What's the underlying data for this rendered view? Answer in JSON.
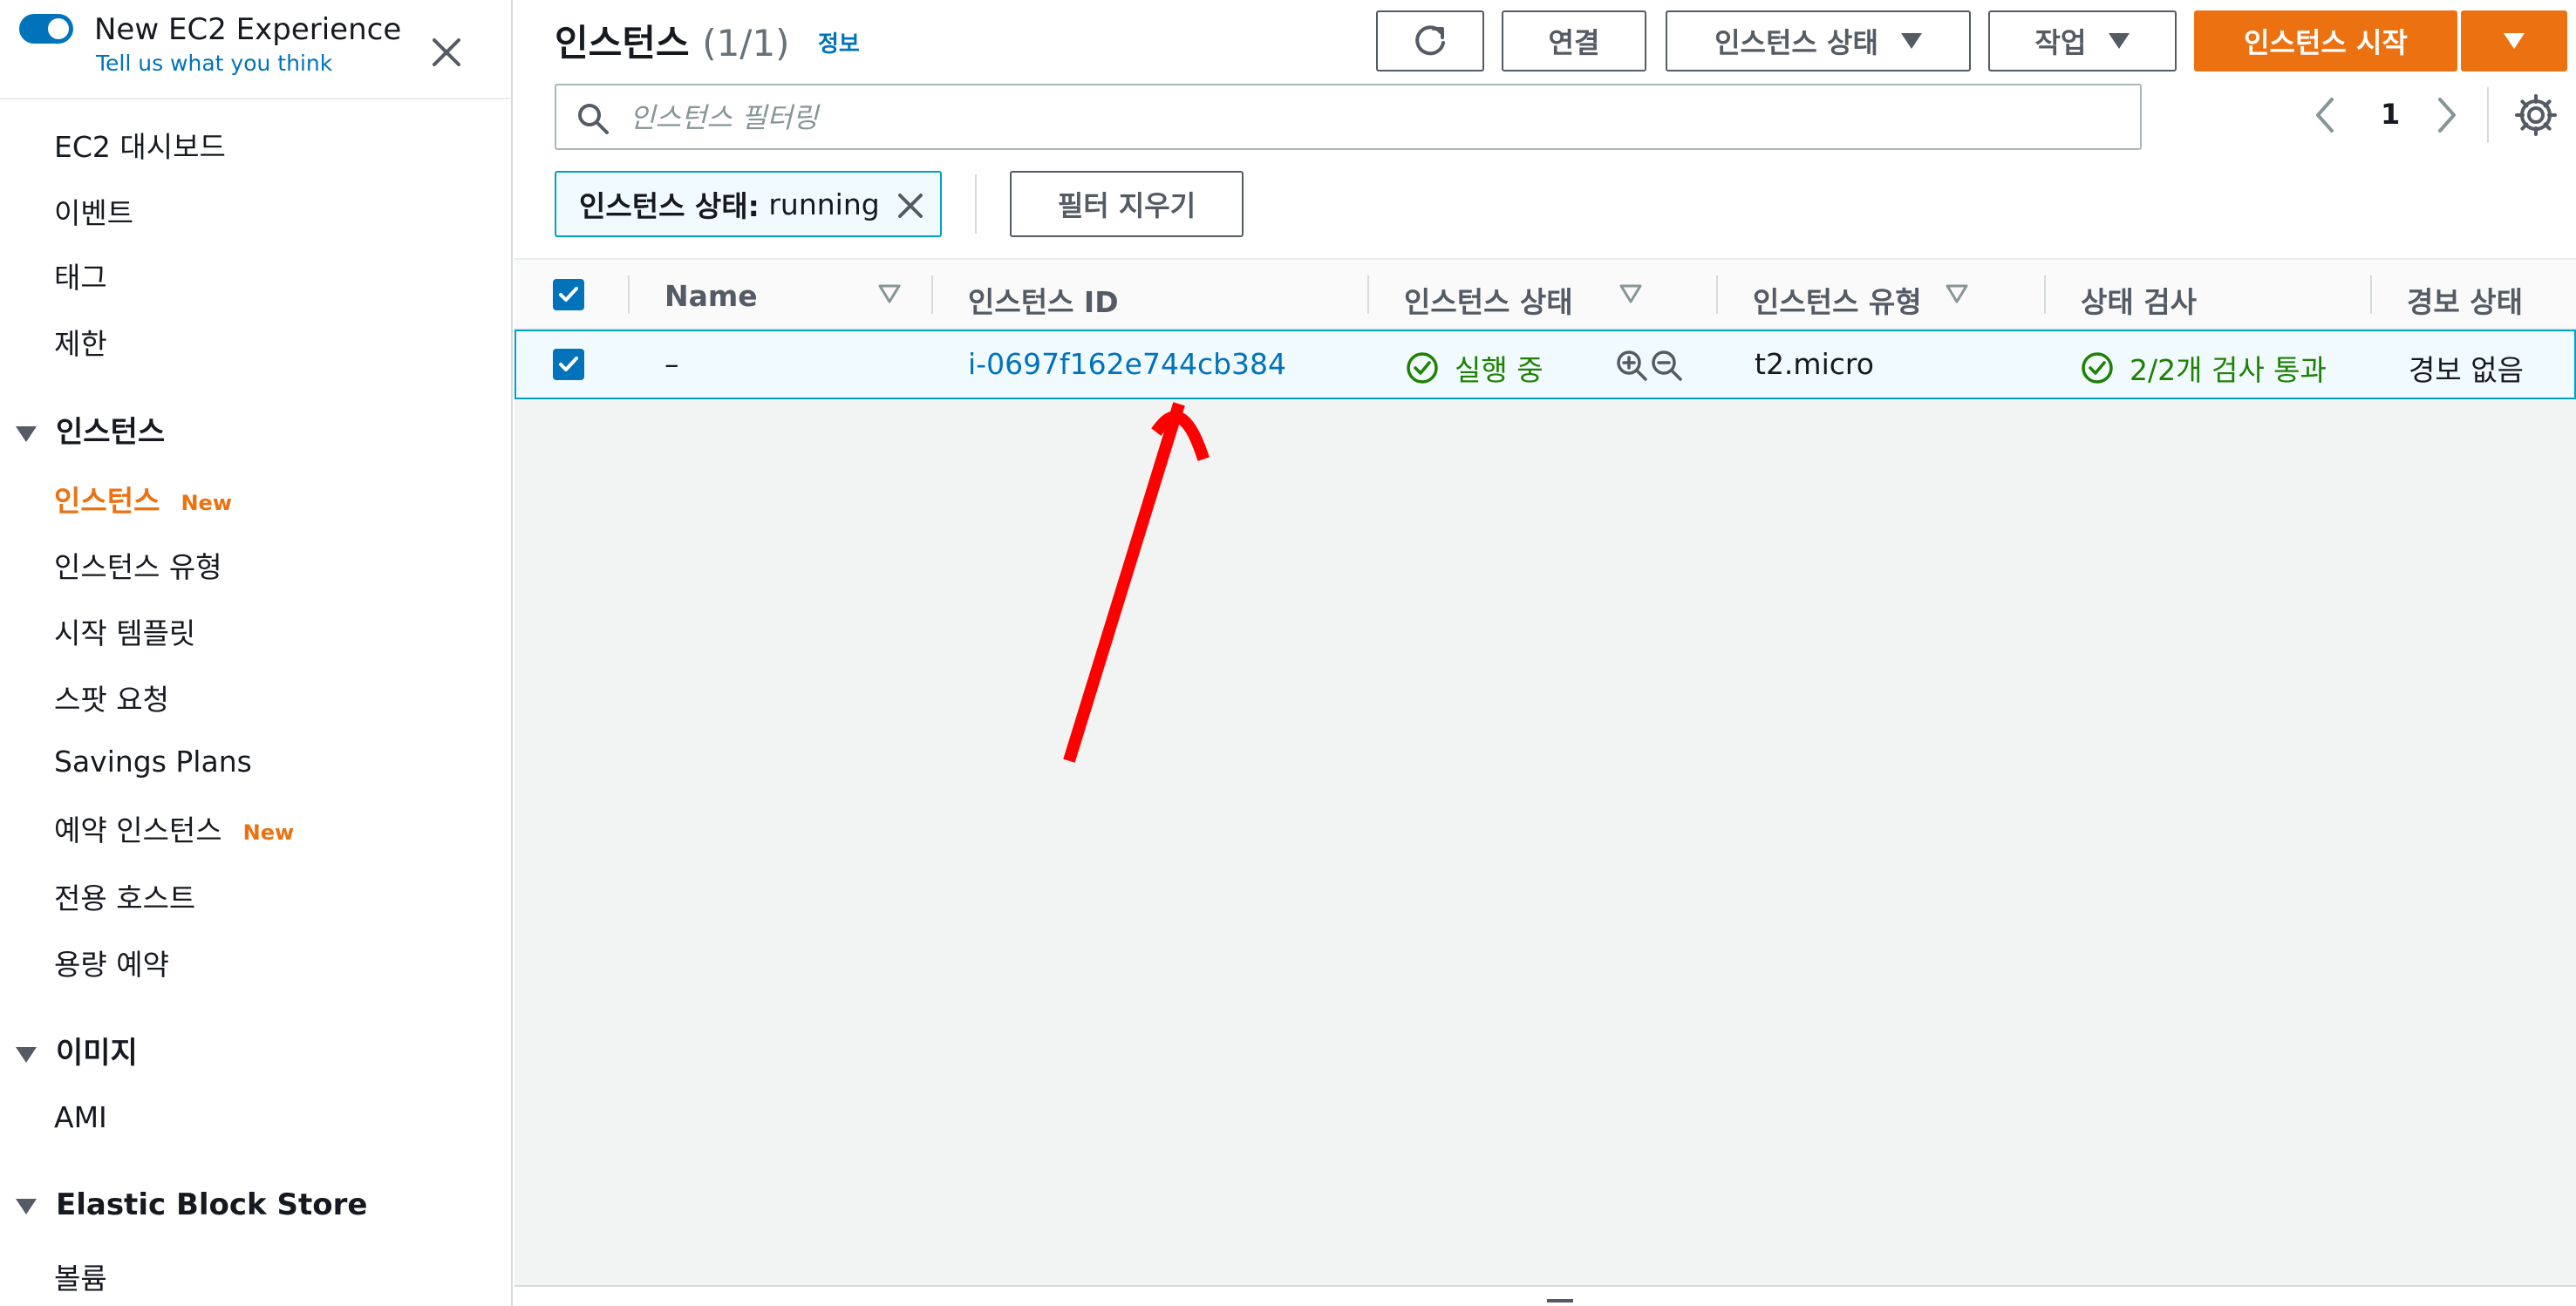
{
  "sidebar": {
    "new_experience": {
      "title": "New EC2 Experience",
      "feedback_link": "Tell us what you think"
    },
    "top_items": [
      {
        "label": "EC2 대시보드"
      },
      {
        "label": "이벤트"
      },
      {
        "label": "태그"
      },
      {
        "label": "제한"
      }
    ],
    "sections": [
      {
        "title": "인스턴스",
        "items": [
          {
            "label": "인스턴스",
            "badge": "New",
            "active": true
          },
          {
            "label": "인스턴스 유형"
          },
          {
            "label": "시작 템플릿"
          },
          {
            "label": "스팟 요청"
          },
          {
            "label": "Savings Plans"
          },
          {
            "label": "예약 인스턴스",
            "badge": "New"
          },
          {
            "label": "전용 호스트"
          },
          {
            "label": "용량 예약"
          }
        ]
      },
      {
        "title": "이미지",
        "items": [
          {
            "label": "AMI"
          }
        ]
      },
      {
        "title": "Elastic Block Store",
        "items": [
          {
            "label": "볼륨"
          }
        ]
      }
    ]
  },
  "header": {
    "title": "인스턴스",
    "count": "(1/1)",
    "info_link": "정보",
    "buttons": {
      "connect": "연결",
      "instance_state": "인스턴스 상태",
      "actions": "작업",
      "launch": "인스턴스 시작"
    }
  },
  "search": {
    "placeholder": "인스턴스 필터링",
    "value": ""
  },
  "pagination": {
    "current_page": "1"
  },
  "filter": {
    "token_key": "인스턴스 상태:",
    "token_value": "running",
    "clear_label": "필터 지우기"
  },
  "table": {
    "columns": [
      "Name",
      "인스턴스 ID",
      "인스턴스 상태",
      "인스턴스 유형",
      "상태 검사",
      "경보 상태"
    ],
    "rows": [
      {
        "name": "–",
        "instance_id": "i-0697f162e744cb384",
        "state": "실행 중",
        "type": "t2.micro",
        "status_check": "2/2개 검사 통과",
        "alarm_status": "경보 없음"
      }
    ]
  },
  "colors": {
    "accent": "#0073bb",
    "primary_button": "#ec7211",
    "success": "#1d8102",
    "selection_border": "#00a1c9",
    "annotation": "#ff0000"
  },
  "icons": {
    "toggle": "toggle-switch-on",
    "close": "close-icon",
    "refresh": "refresh-icon",
    "search": "search-icon",
    "settings": "gear-icon",
    "status_ok": "check-circle-icon"
  }
}
